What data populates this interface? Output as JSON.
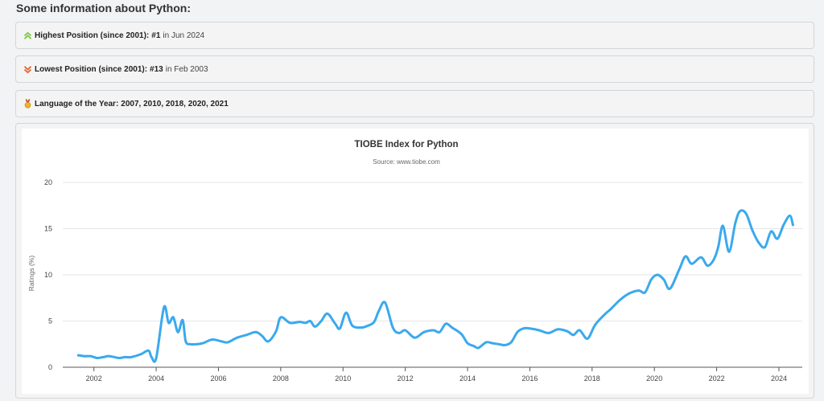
{
  "heading": "Some information about Python:",
  "info": {
    "highest": {
      "label": "Highest Position (since 2001):",
      "value": "#1",
      "extra": "in Jun 2024",
      "icon": "double-chevron-up-icon",
      "color": "#7ac943"
    },
    "lowest": {
      "label": "Lowest Position (since 2001):",
      "value": "#13",
      "extra": "in Feb 2003",
      "icon": "double-chevron-down-icon",
      "color": "#e8622c"
    },
    "year": {
      "label": "Language of the Year:",
      "value": "2007, 2010, 2018, 2020, 2021",
      "icon": "medal-icon",
      "color": "#f0a020"
    }
  },
  "chart_data": {
    "type": "line",
    "title": "TIOBE Index for Python",
    "subtitle": "Source: www.tiobe.com",
    "xlabel": "",
    "ylabel": "Ratings (%)",
    "xlim": [
      2001.0,
      2024.75
    ],
    "ylim": [
      0,
      20
    ],
    "x_ticks": [
      "2002",
      "2004",
      "2006",
      "2008",
      "2010",
      "2012",
      "2014",
      "2016",
      "2018",
      "2020",
      "2022",
      "2024"
    ],
    "y_ticks": [
      "0",
      "5",
      "10",
      "15",
      "20"
    ],
    "grid": true,
    "color": "#3aa9ee",
    "series": [
      {
        "x": [
          2001.5,
          2001.7,
          2001.9,
          2002.1,
          2002.3,
          2002.5,
          2002.8,
          2003.0,
          2003.2,
          2003.5,
          2003.75,
          2003.85,
          2004.0,
          2004.25,
          2004.4,
          2004.55,
          2004.7,
          2004.85,
          2004.95,
          2005.1,
          2005.3,
          2005.5,
          2005.8,
          2006.1,
          2006.3,
          2006.6,
          2006.9,
          2007.2,
          2007.4,
          2007.6,
          2007.85,
          2008.0,
          2008.3,
          2008.6,
          2008.8,
          2008.95,
          2009.1,
          2009.3,
          2009.5,
          2009.75,
          2009.9,
          2010.1,
          2010.3,
          2010.6,
          2010.8,
          2011.0,
          2011.15,
          2011.35,
          2011.6,
          2011.8,
          2012.0,
          2012.3,
          2012.6,
          2012.9,
          2013.1,
          2013.3,
          2013.5,
          2013.8,
          2014.0,
          2014.2,
          2014.35,
          2014.6,
          2014.8,
          2015.0,
          2015.2,
          2015.4,
          2015.6,
          2015.8,
          2016.0,
          2016.3,
          2016.6,
          2016.9,
          2017.2,
          2017.4,
          2017.6,
          2017.85,
          2018.1,
          2018.4,
          2018.6,
          2018.9,
          2019.2,
          2019.5,
          2019.7,
          2019.9,
          2020.1,
          2020.3,
          2020.5,
          2020.8,
          2021.0,
          2021.2,
          2021.5,
          2021.7,
          2021.9,
          2022.05,
          2022.2,
          2022.4,
          2022.6,
          2022.75,
          2022.95,
          2023.15,
          2023.35,
          2023.55,
          2023.75,
          2023.95,
          2024.15,
          2024.35,
          2024.45
        ],
        "y": [
          1.3,
          1.2,
          1.2,
          1.0,
          1.1,
          1.2,
          1.0,
          1.1,
          1.1,
          1.4,
          1.8,
          1.1,
          1.0,
          6.5,
          4.8,
          5.4,
          3.8,
          5.1,
          2.8,
          2.5,
          2.5,
          2.6,
          3.0,
          2.8,
          2.7,
          3.2,
          3.5,
          3.8,
          3.4,
          2.8,
          3.9,
          5.4,
          4.8,
          4.9,
          4.8,
          5.0,
          4.4,
          5.0,
          5.8,
          4.7,
          4.2,
          5.9,
          4.5,
          4.3,
          4.5,
          4.9,
          6.1,
          7.0,
          4.3,
          3.7,
          4.0,
          3.2,
          3.8,
          4.0,
          3.8,
          4.7,
          4.3,
          3.6,
          2.6,
          2.3,
          2.1,
          2.7,
          2.6,
          2.5,
          2.4,
          2.7,
          3.8,
          4.2,
          4.2,
          4.0,
          3.7,
          4.1,
          3.9,
          3.5,
          4.0,
          3.1,
          4.6,
          5.7,
          6.3,
          7.3,
          8.0,
          8.3,
          8.1,
          9.5,
          10.0,
          9.5,
          8.5,
          10.6,
          12.0,
          11.2,
          11.9,
          11.0,
          11.6,
          13.0,
          15.3,
          12.5,
          15.6,
          16.9,
          16.6,
          14.8,
          13.5,
          13.0,
          14.7,
          13.9,
          15.4,
          16.4,
          15.4
        ]
      }
    ]
  }
}
